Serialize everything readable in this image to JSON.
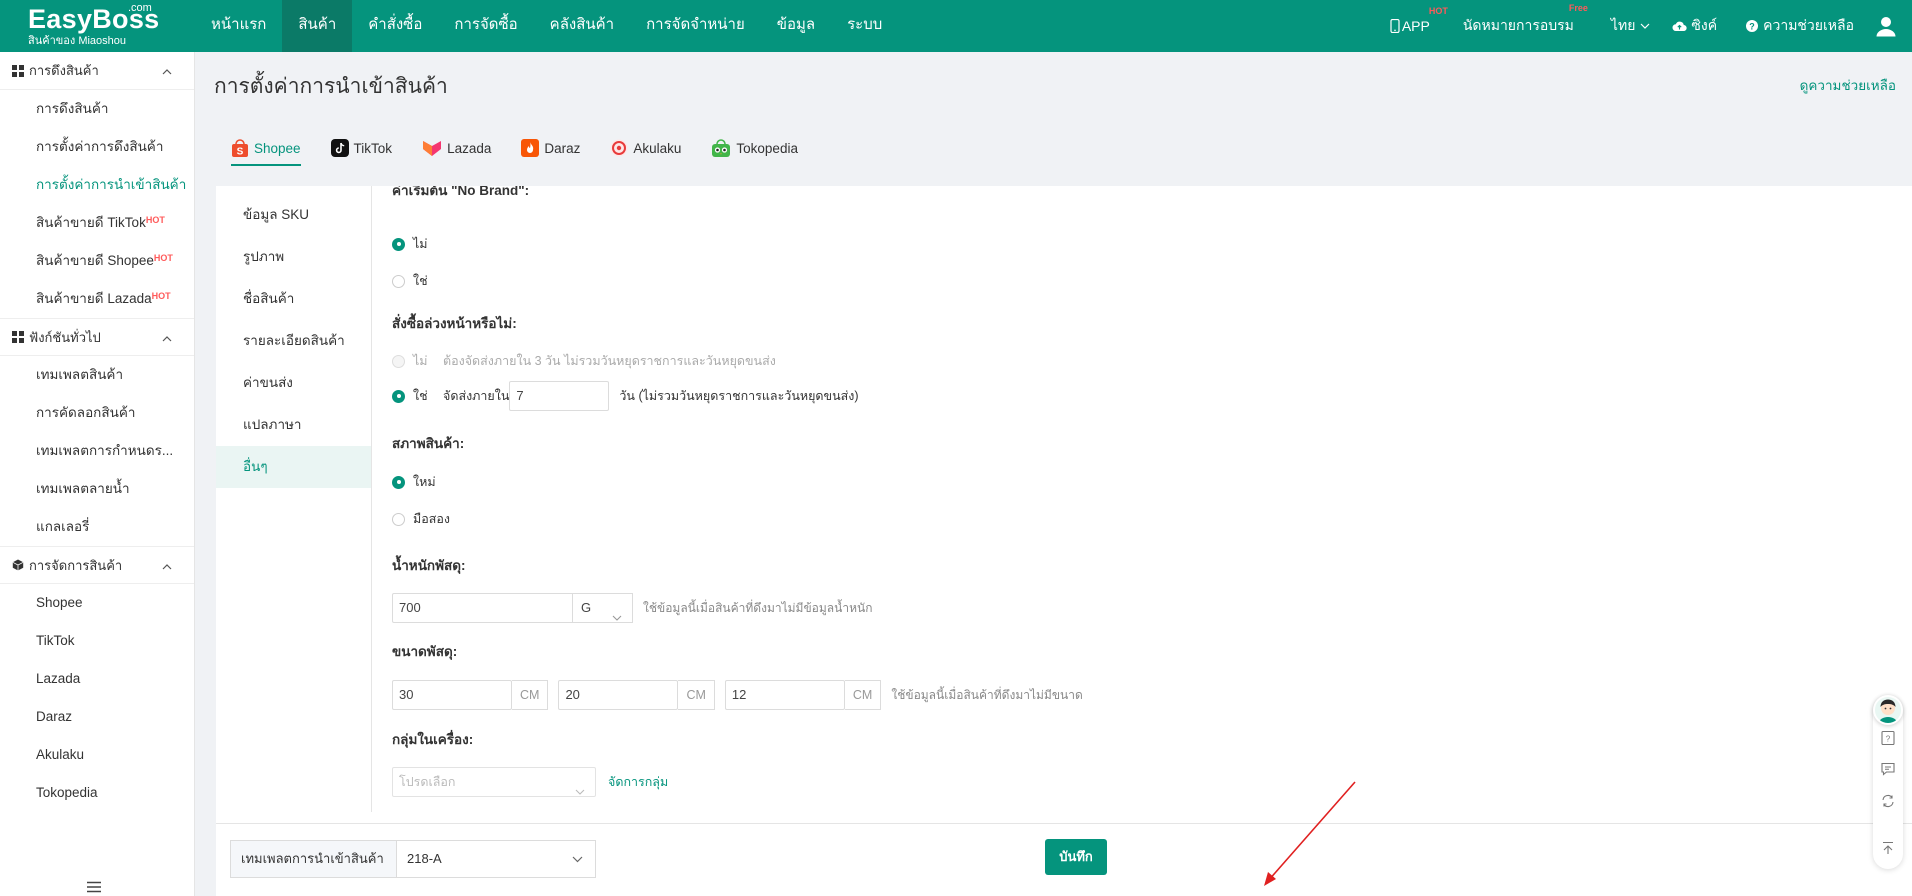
{
  "header": {
    "brand": "EasyBoss",
    "brand_suffix": ".com",
    "brand_sub": "สินค้าของ Miaoshou",
    "nav": [
      "หน้าแรก",
      "สินค้า",
      "คำสั่งซื้อ",
      "การจัดซื้อ",
      "คลังสินค้า",
      "การจัดจำหน่าย",
      "ข้อมูล",
      "ระบบ"
    ],
    "active_nav": "สินค้า",
    "right": {
      "app": "APP",
      "app_badge": "HOT",
      "training": "นัดหมายการอบรม",
      "training_badge": "Free",
      "language": "ไทย",
      "sync": "ซิงค์",
      "help": "ความช่วยเหลือ"
    }
  },
  "sidebar": {
    "groups": [
      {
        "title": "การดึงสินค้า",
        "items": [
          {
            "label": "การดึงสินค้า"
          },
          {
            "label": "การตั้งค่าการดึงสินค้า"
          },
          {
            "label": "การตั้งค่าการนำเข้าสินค้า",
            "active": true
          },
          {
            "label": "สินค้าขายดี TikTok",
            "badge": "HOT"
          },
          {
            "label": "สินค้าขายดี Shopee",
            "badge": "HOT"
          },
          {
            "label": "สินค้าขายดี Lazada",
            "badge": "HOT"
          }
        ]
      },
      {
        "title": "ฟังก์ชันทั่วไป",
        "items": [
          {
            "label": "เทมเพลตสินค้า"
          },
          {
            "label": "การคัดลอกสินค้า"
          },
          {
            "label": "เทมเพลตการกำหนดร..."
          },
          {
            "label": "เทมเพลตลายน้ำ"
          },
          {
            "label": "แกลเลอรี่"
          }
        ]
      },
      {
        "title": "การจัดการสินค้า",
        "items": [
          {
            "label": "Shopee"
          },
          {
            "label": "TikTok"
          },
          {
            "label": "Lazada"
          },
          {
            "label": "Daraz"
          },
          {
            "label": "Akulaku"
          },
          {
            "label": "Tokopedia"
          }
        ]
      }
    ]
  },
  "page": {
    "title": "การตั้งค่าการนำเข้าสินค้า",
    "help_link": "ดูความช่วยเหลือ"
  },
  "platform_tabs": [
    {
      "label": "Shopee",
      "icon": "shopee-icon",
      "color": "#ee4d2d"
    },
    {
      "label": "TikTok",
      "icon": "tiktok-icon",
      "color": "#111111"
    },
    {
      "label": "Lazada",
      "icon": "lazada-icon",
      "color": "#f5366f"
    },
    {
      "label": "Daraz",
      "icon": "daraz-icon",
      "color": "#f85606"
    },
    {
      "label": "Akulaku",
      "icon": "akulaku-icon",
      "color": "#e83b3b"
    },
    {
      "label": "Tokopedia",
      "icon": "tokopedia-icon",
      "color": "#42b549"
    }
  ],
  "settings_nav": [
    "ข้อมูล SKU",
    "รูปภาพ",
    "ชื่อสินค้า",
    "รายละเอียดสินค้า",
    "ค่าขนส่ง",
    "แปลภาษา",
    "อื่นๆ"
  ],
  "settings_nav_active": "อื่นๆ",
  "form": {
    "brand_cut_title": "ค่าเริ่มต้น \"No Brand\":",
    "brand_options": {
      "no": "ไม่",
      "yes": "ใช่"
    },
    "preorder": {
      "title": "สั่งซื้อล่วงหน้าหรือไม่:",
      "no_label": "ไม่",
      "no_desc": "ต้องจัดส่งภายใน 3 วัน ไม่รวมวันหยุดราชการและวันหยุดขนส่ง",
      "yes_label": "ใช่",
      "yes_prefix": "จัดส่งภายใน",
      "days_value": "7",
      "yes_suffix": "วัน  (ไม่รวมวันหยุดราชการและวันหยุดขนส่ง)"
    },
    "condition": {
      "title": "สภาพสินค้า:",
      "new": "ใหม่",
      "used": "มือสอง"
    },
    "weight": {
      "title": "น้ำหนักพัสดุ:",
      "value": "700",
      "unit": "G",
      "hint": "ใช้ข้อมูลนี้เมื่อสินค้าที่ดึงมาไม่มีข้อมูลน้ำหนัก"
    },
    "dimensions": {
      "title": "ขนาดพัสดุ:",
      "length": "30",
      "width": "20",
      "height": "12",
      "unit": "CM",
      "hint": "ใช้ข้อมูลนี้เมื่อสินค้าที่ดึงมาไม่มีขนาด"
    },
    "group": {
      "title": "กลุ่มในเครื่อง:",
      "placeholder": "โปรดเลือก",
      "manage_link": "จัดการกลุ่ม"
    }
  },
  "footer": {
    "template_label": "เทมเพลตการนำเข้าสินค้า",
    "template_value": "218-A",
    "save": "บันทึก"
  },
  "colors": {
    "primary": "#05947d",
    "hot": "#ff5a5a",
    "annotation_arrow": "#e02020"
  }
}
